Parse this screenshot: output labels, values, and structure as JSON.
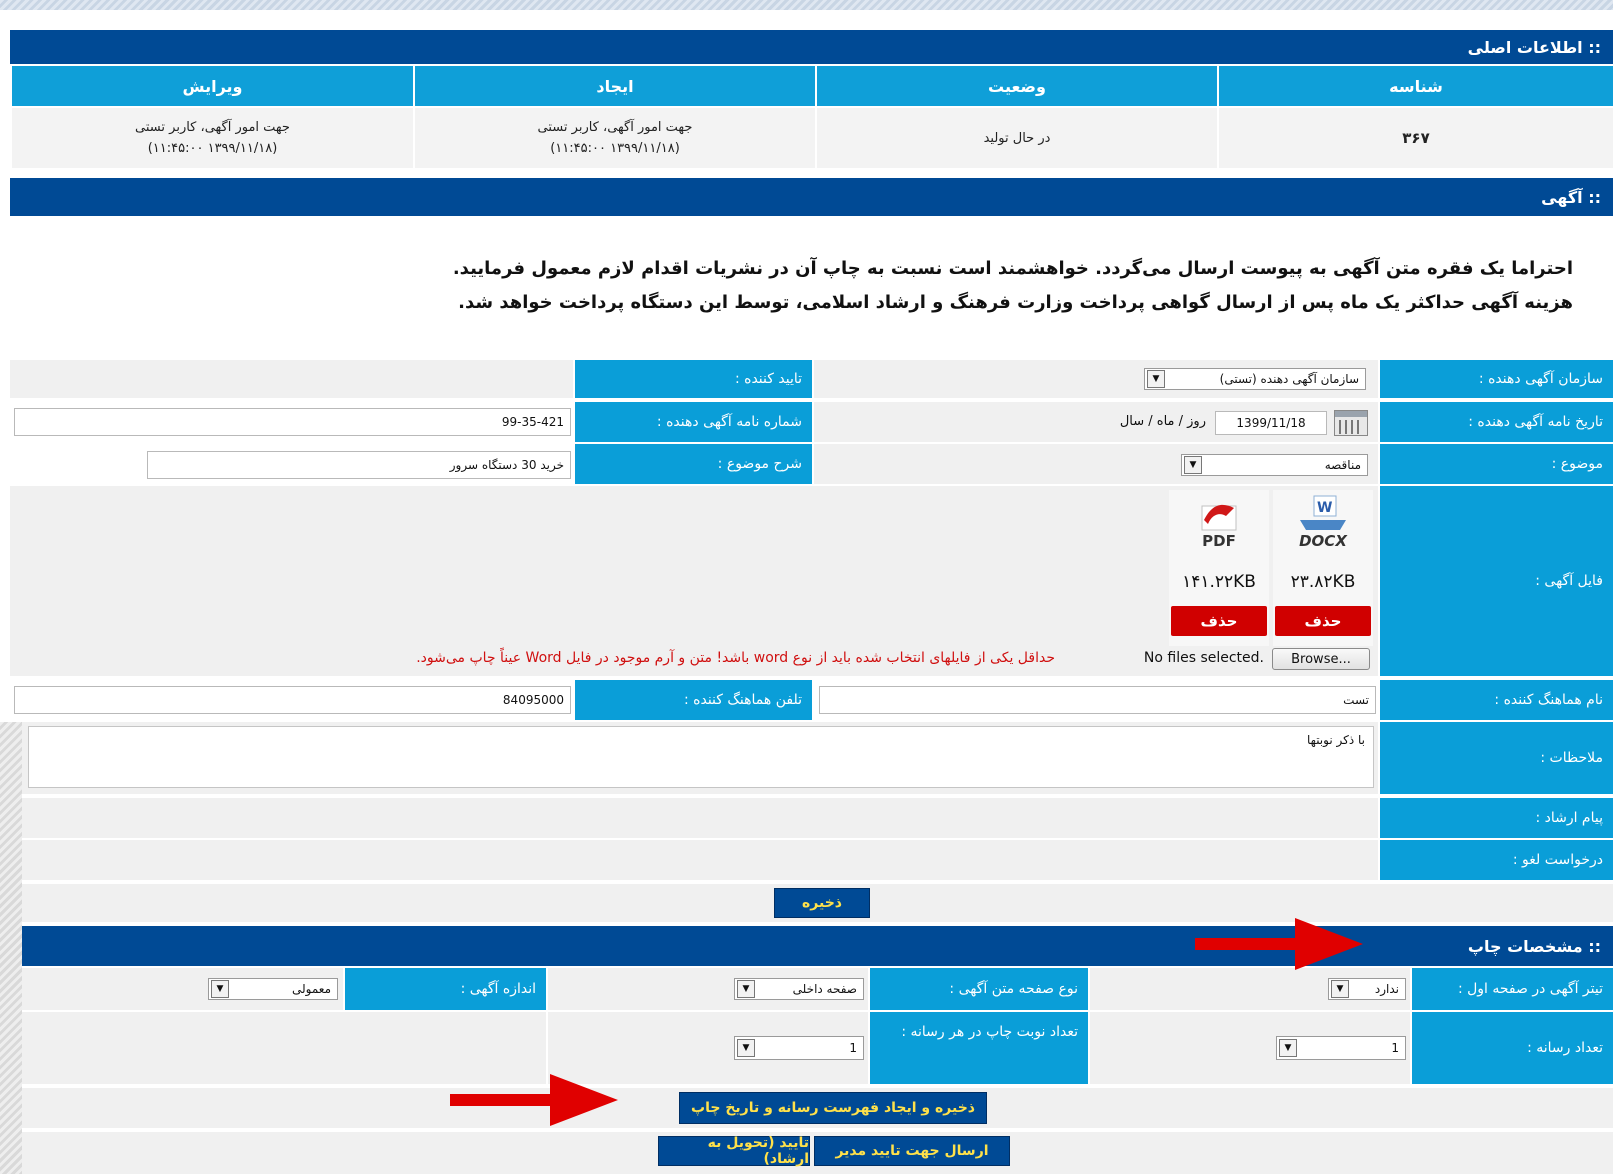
{
  "main_info": {
    "title": ":: اطلاعات اصلی",
    "columns": [
      "شناسه",
      "وضعیت",
      "ایجاد",
      "ویرایش"
    ],
    "row": {
      "id": "۳۶۷",
      "status": "در حال تولید",
      "created_by": "جهت امور آگهی، کاربر تستی",
      "created_at": "(۱۳۹۹/۱۱/۱۸ ۱۱:۴۵:۰۰)",
      "edited_by": "جهت امور آگهی، کاربر تستی",
      "edited_at": "(۱۳۹۹/۱۱/۱۸ ۱۱:۴۵:۰۰)"
    }
  },
  "ad": {
    "title": ":: آگهی",
    "notice_line1": "احتراما یک فقره متن آگهی به پیوست ارسال می‌گردد. خواهشمند است نسبت به چاپ آن در نشریات اقدام لازم معمول فرمایید.",
    "notice_line2": "هزینه آگهی حداکثر یک ماه پس از ارسال گواهی پرداخت وزارت فرهنگ و ارشاد اسلامی، توسط این دستگاه پرداخت خواهد شد."
  },
  "form": {
    "advertiser_org_label": "سازمان آگهی دهنده :",
    "advertiser_org_value": "سازمان آگهی دهنده (تستی)",
    "approver_label": "تایید کننده :",
    "letter_date_label": "تاریخ نامه آگهی دهنده :",
    "letter_date_value": "1399/11/18",
    "date_format_hint": "روز / ماه / سال",
    "letter_number_label": "شماره نامه آگهی دهنده :",
    "letter_number_value": "99-35-421",
    "subject_label": "موضوع :",
    "subject_value": "مناقصه",
    "subject_desc_label": "شرح موضوع :",
    "subject_desc_value": "خرید 30 دستگاه سرور",
    "file_label": "فایل آگهی :",
    "files": [
      {
        "type": "DOCX",
        "size": "۲۳.۸۲KB",
        "delete_label": "حذف",
        "icon": "docx-file-icon"
      },
      {
        "type": "PDF",
        "size": "۱۴۱.۲۲KB",
        "delete_label": "حذف",
        "icon": "pdf-file-icon"
      }
    ],
    "browse_label": "Browse...",
    "no_files_text": "No files selected.",
    "file_warning": "حداقل یکی از فایلهای انتخاب شده باید از نوع word باشد! متن و آرم موجود در فایل Word عیناً چاپ می‌شود.",
    "coordinator_name_label": "نام هماهنگ کننده :",
    "coordinator_name_value": "تست",
    "coordinator_phone_label": "تلفن هماهنگ کننده :",
    "coordinator_phone_value": "84095000",
    "notes_label": "ملاحظات :",
    "notes_value": "با ذکر نوبتها",
    "guidance_label": "پیام ارشاد :",
    "cancel_request_label": "درخواست لغو :",
    "save_label": "ذخیره"
  },
  "print_specs": {
    "title": ":: مشخصات چاپ",
    "headline_label": "تیتر آگهی در صفحه اول :",
    "headline_value": "ندارد",
    "page_type_label": "نوع صفحه متن آگهی :",
    "page_type_value": "صفحه داخلی",
    "size_label": "اندازه آگهی :",
    "size_value": "معمولی",
    "media_count_label": "تعداد رسانه :",
    "media_count_value": "1",
    "print_turns_label": "تعداد نوبت چاپ در هر رسانه :",
    "print_turns_value": "1",
    "save_media_label": "ذخیره و ایجاد فهرست رسانه و تاریخ چاپ",
    "send_manager_label": "ارسال جهت تایید مدیر",
    "approve_label": "تایید (تحویل به ارشاد)"
  },
  "colors": {
    "section_header": "#004a95",
    "column_header": "#0f9fd8",
    "label_bg": "#0a9ed8",
    "button_bg": "#004a95",
    "button_text": "#ffe14a",
    "delete_button": "#d00000",
    "warning_text": "#d01010",
    "annotation_arrow": "#e00000"
  }
}
